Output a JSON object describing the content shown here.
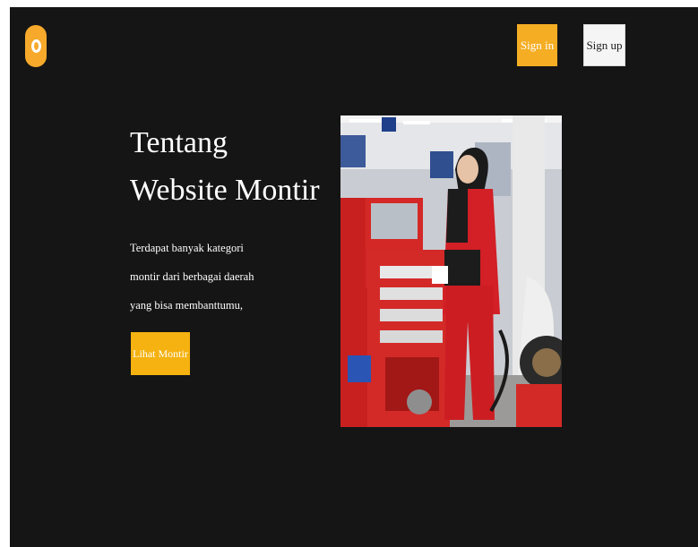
{
  "header": {
    "logo_icon": "ring-logo-icon",
    "sign_in_label": "Sign in",
    "sign_up_label": "Sign up"
  },
  "hero": {
    "title_line1": "Tentang",
    "title_line2": "Website Montir",
    "description": "Terdapat banyak kategori montir dari berbagai daerah yang bisa membanttumu,",
    "cta_label": "Lihat Montir",
    "image_subject": "mechanic-photo"
  },
  "colors": {
    "background": "#151515",
    "accent": "#f5ad23",
    "cta": "#f5b210",
    "text": "#ffffff"
  }
}
